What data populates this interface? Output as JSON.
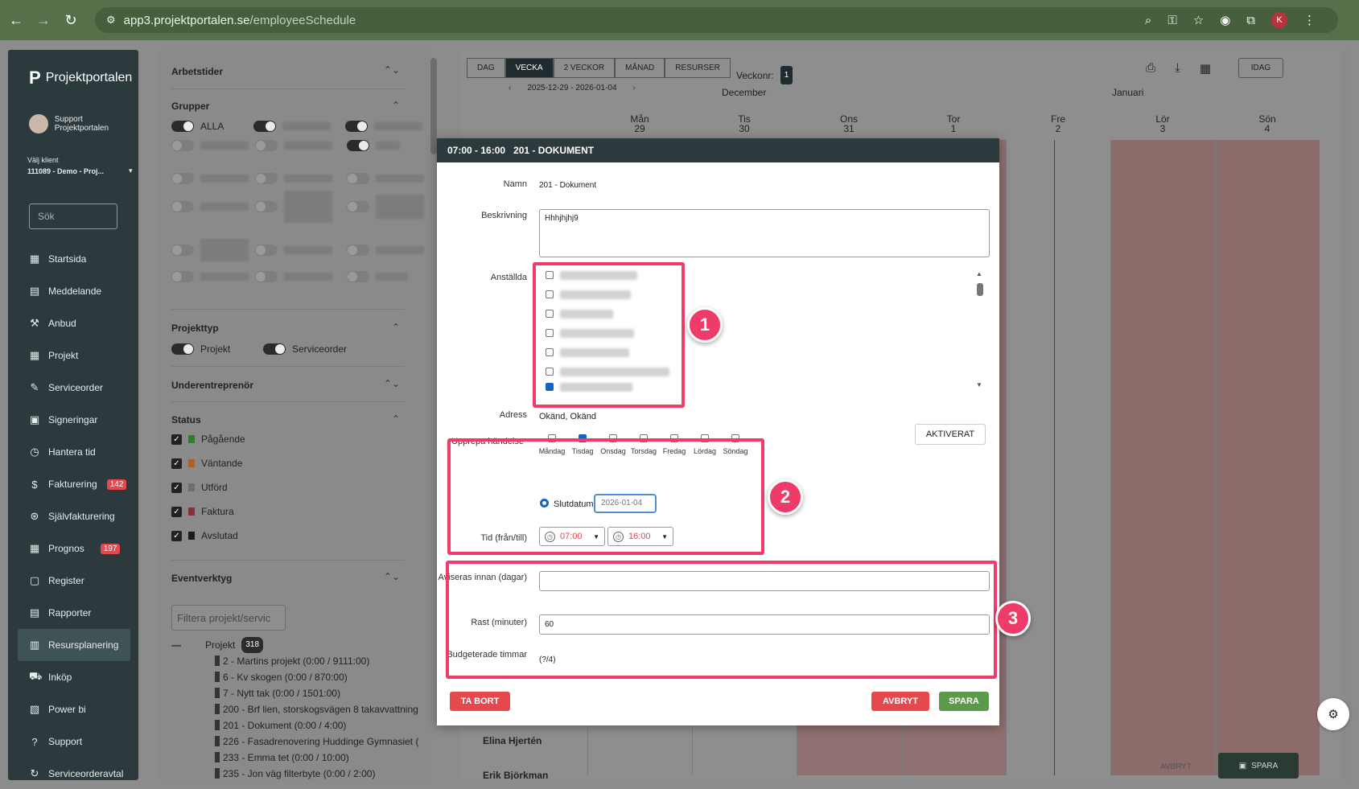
{
  "browser": {
    "url_host": "app3.projektportalen.se",
    "url_path": "/employeeSchedule",
    "profile_initial": "K"
  },
  "sidebar": {
    "brand": "Projektportalen",
    "user_name": "Support Projektportalen",
    "client_label": "Välj klient",
    "client_value": "111089 - Demo - Proj...",
    "search_placeholder": "Sök",
    "items": [
      {
        "label": "Startsida",
        "icon": "dashboard-icon"
      },
      {
        "label": "Meddelande",
        "icon": "message-icon"
      },
      {
        "label": "Anbud",
        "icon": "gavel-icon"
      },
      {
        "label": "Projekt",
        "icon": "grid-icon"
      },
      {
        "label": "Serviceorder",
        "icon": "wrench-icon"
      },
      {
        "label": "Signeringar",
        "icon": "signature-icon"
      },
      {
        "label": "Hantera tid",
        "icon": "clock-icon"
      },
      {
        "label": "Fakturering",
        "icon": "dollar-icon",
        "badge": "142"
      },
      {
        "label": "Självfakturering",
        "icon": "coin-icon"
      },
      {
        "label": "Prognos",
        "icon": "grid-icon",
        "badge": "197"
      },
      {
        "label": "Register",
        "icon": "register-icon"
      },
      {
        "label": "Rapporter",
        "icon": "report-icon"
      },
      {
        "label": "Resursplanering",
        "icon": "calendar-icon",
        "active": true
      },
      {
        "label": "Inköp",
        "icon": "cart-icon"
      },
      {
        "label": "Power bi",
        "icon": "chart-icon"
      },
      {
        "label": "Support",
        "icon": "help-icon"
      },
      {
        "label": "Serviceorderavtal",
        "icon": "refresh-icon"
      }
    ]
  },
  "filters": {
    "arbetstider": "Arbetstider",
    "grupper": "Grupper",
    "alla": "ALLA",
    "projekttyp": "Projekttyp",
    "projekt_toggle": "Projekt",
    "serviceorder_toggle": "Serviceorder",
    "underentreprenor": "Underentreprenör",
    "status": "Status",
    "statuses": [
      {
        "label": "Pågående",
        "color": "#2e7d32"
      },
      {
        "label": "Väntande",
        "color": "#b85c1a"
      },
      {
        "label": "Utförd",
        "color": "#7a7a7a"
      },
      {
        "label": "Faktura",
        "color": "#8a2e3a"
      },
      {
        "label": "Avslutad",
        "color": "#1a1a1a"
      }
    ],
    "eventverktyg": "Eventverktyg",
    "filter_placeholder": "Filtera projekt/servic",
    "tree_root": "Projekt",
    "tree_count": "318",
    "tree_items": [
      "2 - Martins projekt (0:00 / 9111:00)",
      "6 - Kv skogen (0:00 / 870:00)",
      "7 - Nytt tak (0:00 / 1501:00)",
      "200 - Brf lien, storskogsvägen 8 takavvattning",
      "201 - Dokument (0:00 / 4:00)",
      "226 - Fasadrenovering Huddinge Gymnasiet (",
      "233 - Emma tet (0:00 / 10:00)",
      "235 - Jon väg filterbyte (0:00 / 2:00)"
    ]
  },
  "calendar": {
    "tabs": [
      "DAG",
      "VECKA",
      "2 VECKOR",
      "MÅNAD",
      "RESURSER"
    ],
    "active_tab": "VECKA",
    "veckonr_label": "Veckonr:",
    "veckonr": "1",
    "daterange": "2025-12-29 - 2026-01-04",
    "month_left": "December",
    "month_right": "Januari",
    "idag": "IDAG",
    "days": [
      {
        "name": "Mån",
        "num": "29"
      },
      {
        "name": "Tis",
        "num": "30"
      },
      {
        "name": "Ons",
        "num": "31"
      },
      {
        "name": "Tor",
        "num": "1"
      },
      {
        "name": "Fre",
        "num": "2"
      },
      {
        "name": "Lör",
        "num": "3"
      },
      {
        "name": "Sön",
        "num": "4"
      }
    ],
    "rows": [
      "Elina Hjertén",
      "Erik Björkman"
    ],
    "avbryt": "AVBRYT",
    "spara": "SPARA"
  },
  "modal": {
    "header_time": "07:00 - 16:00",
    "header_title": "201 - DOKUMENT",
    "namn_label": "Namn",
    "namn_value": "201 - Dokument",
    "beskrivning_label": "Beskrivning",
    "beskrivning_value": "Hhhjhjhj9",
    "anstallda_label": "Anställda",
    "adress_label": "Adress",
    "adress_value": "Okänd, Okänd",
    "upprepa_label": "Upprepa händelse",
    "aktiverat": "AKTIVERAT",
    "weekdays": [
      {
        "label": "Måndag",
        "checked": false
      },
      {
        "label": "Tisdag",
        "checked": true
      },
      {
        "label": "Onsdag",
        "checked": false
      },
      {
        "label": "Torsdag",
        "checked": false
      },
      {
        "label": "Fredag",
        "checked": false
      },
      {
        "label": "Lördag",
        "checked": false
      },
      {
        "label": "Söndag",
        "checked": false
      }
    ],
    "slutdatum_label": "Slutdatum",
    "slutdatum_value": "2026-01-04",
    "tid_label": "Tid (från/till)",
    "tid_from": "07:00",
    "tid_to": "16:00",
    "aviseras_label": "Aviseras innan (dagar)",
    "aviseras_value": "",
    "rast_label": "Rast (minuter)",
    "rast_value": "60",
    "budget_label": "Budgeterade timmar",
    "budget_value": "(?/4)",
    "ta_bort": "TA BORT",
    "avbryt": "AVBRYT",
    "spara": "SPARA"
  },
  "annotations": [
    "1",
    "2",
    "3"
  ],
  "colors": {
    "highlight": "#ee3b6a",
    "danger": "#e5484d",
    "success": "#5a9a4a",
    "nav_bg": "#2c3a3e"
  }
}
